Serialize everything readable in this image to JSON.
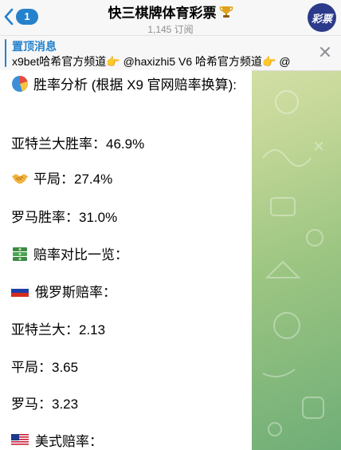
{
  "header": {
    "back_badge": "1",
    "title": "快三棋牌体育彩票",
    "subtitle": "1,145 订阅",
    "avatar_text": "彩票"
  },
  "pinned": {
    "title": "置顶消息",
    "text": "x9bet哈希官方频道👉 @haxizhi5 V6 哈希官方频道👉 @"
  },
  "message": {
    "analysis_title": "胜率分析 (根据 X9 官网赔率换算):",
    "home_win": "亚特兰大胜率：46.9%",
    "draw": "平局：27.4%",
    "away_win": "罗马胜率：31.0%",
    "odds_compare": "赔率对比一览：",
    "russian_odds": "俄罗斯赔率：",
    "ru_home": "亚特兰大：2.13",
    "ru_draw": "平局：3.65",
    "ru_away": "罗马：3.23",
    "us_odds": "美式赔率："
  },
  "icons": {
    "back": "chevron-left-icon",
    "title_trophy": "trophy-icon",
    "pinned_close": "close-icon",
    "analysis": "pie-chart-icon",
    "draw": "handshake-icon",
    "odds": "money-stack-icon",
    "russia": "russia-flag-icon",
    "usa": "usa-flag-icon"
  },
  "colors": {
    "accent": "#2481cc",
    "wallpaper": "#9cc582"
  }
}
